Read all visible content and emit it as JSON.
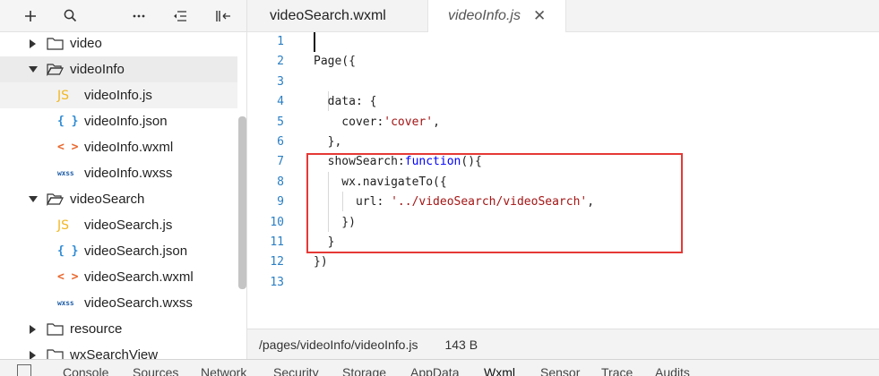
{
  "toolbar": {
    "icons": [
      "plus-icon",
      "search-icon",
      "more-icon",
      "collapse-icon",
      "hide-sidebar-icon"
    ]
  },
  "tree": {
    "items": [
      {
        "label": "video",
        "type": "folder",
        "expanded": false
      },
      {
        "label": "videoInfo",
        "type": "folder",
        "expanded": true
      },
      {
        "label": "videoInfo.js",
        "type": "js",
        "icon": "JS"
      },
      {
        "label": "videoInfo.json",
        "type": "json",
        "icon": "{ }"
      },
      {
        "label": "videoInfo.wxml",
        "type": "wxml",
        "icon": "< >"
      },
      {
        "label": "videoInfo.wxss",
        "type": "wxss",
        "icon": "wxss"
      },
      {
        "label": "videoSearch",
        "type": "folder",
        "expanded": true
      },
      {
        "label": "videoSearch.js",
        "type": "js",
        "icon": "JS"
      },
      {
        "label": "videoSearch.json",
        "type": "json",
        "icon": "{ }"
      },
      {
        "label": "videoSearch.wxml",
        "type": "wxml",
        "icon": "< >"
      },
      {
        "label": "videoSearch.wxss",
        "type": "wxss",
        "icon": "wxss"
      },
      {
        "label": "resource",
        "type": "folder",
        "expanded": false
      },
      {
        "label": "wxSearchView",
        "type": "folder",
        "expanded": false
      }
    ]
  },
  "tabs": [
    {
      "label": "videoSearch.wxml",
      "active": false
    },
    {
      "label": "videoInfo.js",
      "active": true,
      "close": "✕"
    }
  ],
  "code": {
    "line_numbers": [
      "1",
      "2",
      "3",
      "4",
      "5",
      "6",
      "7",
      "8",
      "9",
      "10",
      "11",
      "12",
      "13"
    ],
    "lines": [
      [],
      [
        {
          "t": "Page({"
        }
      ],
      [],
      [
        {
          "t": "  data: {"
        }
      ],
      [
        {
          "t": "    cover:"
        },
        {
          "t": "'cover'",
          "c": "str"
        },
        {
          "t": ","
        }
      ],
      [
        {
          "t": "  },"
        }
      ],
      [
        {
          "t": "  showSearch:"
        },
        {
          "t": "function",
          "c": "kw"
        },
        {
          "t": "(){"
        }
      ],
      [
        {
          "t": "    wx.navigateTo({"
        }
      ],
      [
        {
          "t": "      url: "
        },
        {
          "t": "'../videoSearch/videoSearch'",
          "c": "str"
        },
        {
          "t": ","
        }
      ],
      [
        {
          "t": "    })"
        }
      ],
      [
        {
          "t": "  }"
        }
      ],
      [
        {
          "t": "})"
        }
      ],
      []
    ]
  },
  "status": {
    "path": "/pages/videoInfo/videoInfo.js",
    "size": "143 B"
  },
  "devtools": {
    "tabs": [
      "Console",
      "Sources",
      "Network",
      "Security",
      "Storage",
      "AppData",
      "Wxml",
      "Sensor",
      "Trace",
      "Audits"
    ],
    "active": "Wxml"
  },
  "colors": {
    "highlight_border": "#e53935",
    "line_number": "#2b7fc4",
    "string": "#a31515",
    "keyword": "#0000ff"
  }
}
